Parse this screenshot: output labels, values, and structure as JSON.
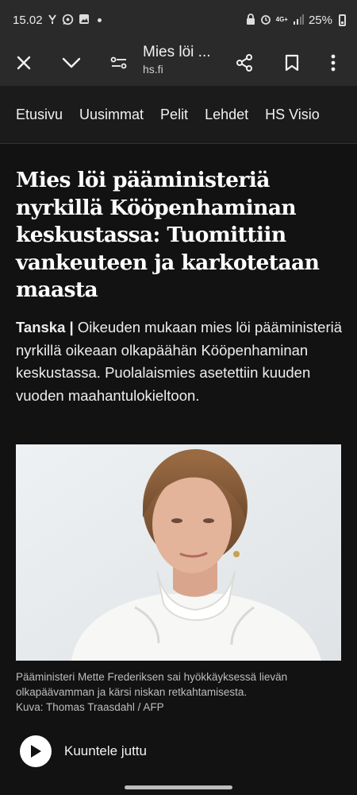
{
  "status_bar": {
    "time": "15.02",
    "network_label": "4G+",
    "battery": "25%",
    "icons": [
      "missed-call-icon",
      "whatsapp-icon",
      "gallery-icon",
      "notification-dot-icon",
      "lock-icon",
      "alarm-icon",
      "network-4g-icon",
      "signal-icon",
      "battery-icon"
    ]
  },
  "toolbar": {
    "title": "Mies löi ...",
    "url": "hs.fi",
    "icons": [
      "close-icon",
      "chevron-down-icon",
      "page-settings-icon",
      "share-icon",
      "bookmark-icon",
      "more-vert-icon"
    ]
  },
  "nav": {
    "items": [
      "Etusivu",
      "Uusimmat",
      "Pelit",
      "Lehdet",
      "HS Visio"
    ]
  },
  "article": {
    "headline": "Mies löi pääministeriä nyrkillä Kööpenhaminan keskustassa: Tuomittiin vankeuteen ja karkotetaan maasta",
    "category": "Tanska |",
    "lead": " Oikeuden mukaan mies löi pääministeriä nyrkillä oikeaan olkapäähän Kööpenhaminan keskustassa. Puolalaismies asetettiin kuuden vuoden maahantulokieltoon.",
    "caption_line": "Pääministeri Mette Frederiksen sai hyökkäyksessä lievän olkapäävamman ja kärsi niskan retkahtamisesta.",
    "credit": "Kuva: Thomas Traasdahl / AFP",
    "listen_label": "Kuuntele juttu"
  },
  "colors": {
    "background": "#121212",
    "toolbar": "#2a2a2a",
    "nav_bar": "#1b1b1b",
    "text": "#f2f2f2",
    "caption": "#bdbdbd"
  }
}
